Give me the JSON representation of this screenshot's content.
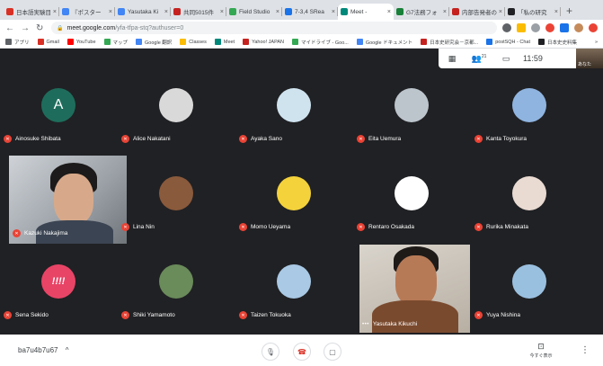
{
  "browser": {
    "tabs": [
      {
        "label": "日本語実験目",
        "color": "#d93025",
        "active": false
      },
      {
        "label": "『ポスター",
        "color": "#4285f4",
        "active": false
      },
      {
        "label": "Yasutaka Ki",
        "color": "#4285f4",
        "active": false
      },
      {
        "label": "共同5015件",
        "color": "#c5221f",
        "active": false
      },
      {
        "label": "Field Studio",
        "color": "#34a853",
        "active": false
      },
      {
        "label": "7-3,4 SRea",
        "color": "#1a73e8",
        "active": false
      },
      {
        "label": "Meet - ",
        "color": "#00897b",
        "active": true
      },
      {
        "label": "G7法務フォ",
        "color": "#188038",
        "active": false
      },
      {
        "label": "内部告発者の",
        "color": "#c5221f",
        "active": false
      },
      {
        "label": "「私の研究",
        "color": "#202124",
        "active": false
      }
    ],
    "new_tab": "+",
    "close_glyph": "×",
    "url_host": "meet.google.com",
    "url_path": "/yfa-tfpa-stq?authuser=0",
    "bookmarks": [
      {
        "label": "アプリ",
        "color": "#5f6368"
      },
      {
        "label": "Gmail",
        "color": "#d93025"
      },
      {
        "label": "YouTube",
        "color": "#ff0000"
      },
      {
        "label": "マップ",
        "color": "#34a853"
      },
      {
        "label": "Google 翻訳",
        "color": "#4285f4"
      },
      {
        "label": "Classes",
        "color": "#fbbc04"
      },
      {
        "label": "Meet",
        "color": "#00897b"
      },
      {
        "label": "Yahoo! JAPAN",
        "color": "#c5221f"
      },
      {
        "label": "マイドライブ - Goo...",
        "color": "#34a853"
      },
      {
        "label": "Google ドキュメント",
        "color": "#4285f4"
      },
      {
        "label": "日本史研究会－京都...",
        "color": "#c5221f"
      },
      {
        "label": "postSQH - Chat",
        "color": "#1a73e8"
      },
      {
        "label": "日本史史料集",
        "color": "#202124"
      }
    ],
    "bookmarks_more": "»"
  },
  "meet": {
    "top": {
      "participants_count": "21",
      "clock": "11:59",
      "self_label": "あなた"
    },
    "participants": [
      {
        "name": "Ainosuke Shibata",
        "initial": "A",
        "bg": "#1e6d5c",
        "muted": true
      },
      {
        "name": "Alice Nakatani",
        "initial": "",
        "bg": "#d9d9d9",
        "muted": true
      },
      {
        "name": "Ayaka Sano",
        "initial": "",
        "bg": "#cfe3ef",
        "muted": true
      },
      {
        "name": "Eita Uemura",
        "initial": "",
        "bg": "#bcc4cc",
        "muted": true
      },
      {
        "name": "Kanta Toyokura",
        "initial": "",
        "bg": "#8fb4e0",
        "muted": true
      },
      {
        "name": "Kazuki Nakajima",
        "initial": "",
        "bg": "",
        "muted": true,
        "video": true
      },
      {
        "name": "Lina Nin",
        "initial": "",
        "bg": "#8a5a3c",
        "muted": true
      },
      {
        "name": "Momo Ueyama",
        "initial": "",
        "bg": "#f4d23b",
        "muted": true
      },
      {
        "name": "Rentaro Osakada",
        "initial": "",
        "bg": "#ffffff",
        "muted": true
      },
      {
        "name": "Rurika Minakata",
        "initial": "",
        "bg": "#e9dad2",
        "muted": true
      },
      {
        "name": "Sena Sekido",
        "initial": "!!!!",
        "bg": "#e84466",
        "muted": true
      },
      {
        "name": "Shiki Yamamoto",
        "initial": "",
        "bg": "#6a8b5a",
        "muted": true
      },
      {
        "name": "Taizen Tokuoka",
        "initial": "",
        "bg": "#a9c9e5",
        "muted": true
      },
      {
        "name": "Yasutaka Kikuchi",
        "initial": "",
        "bg": "",
        "muted": false,
        "video": true
      },
      {
        "name": "Yuya Nishina",
        "initial": "",
        "bg": "#9ac0e0",
        "muted": true
      }
    ]
  },
  "bottom": {
    "meeting_code": "ba7u4b7u67",
    "caret": "^",
    "present_label": "今すぐ表示",
    "more": "⋮"
  },
  "colors": {
    "meet_bg": "#202124",
    "hangup": "#d93025"
  }
}
